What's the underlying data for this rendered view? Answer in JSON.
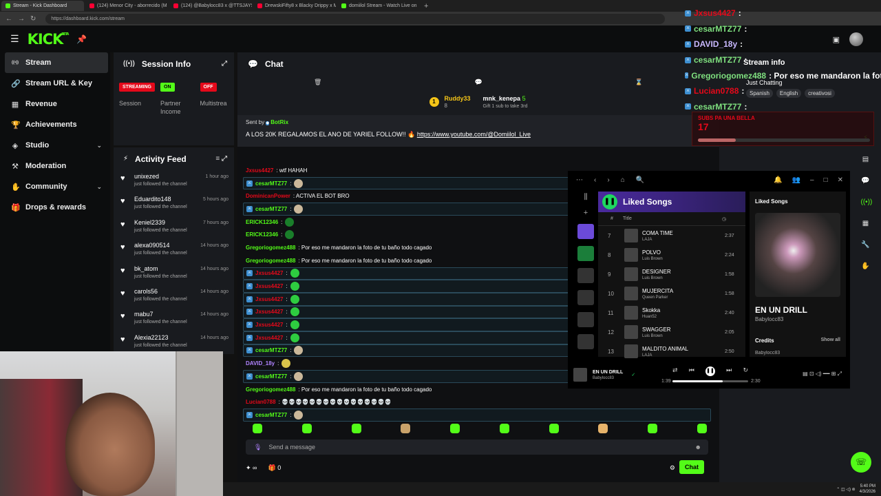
{
  "browser": {
    "tabs": [
      {
        "title": "Stream - Kick Dashboard",
        "color": "#53fc18",
        "active": true
      },
      {
        "title": "(124) Menor City - aborrecido (M",
        "color": "#ff0033",
        "active": false
      },
      {
        "title": "(124) @Babylocc83 x @TTSJAYS",
        "color": "#ff0033",
        "active": false
      },
      {
        "title": "DrewskiFifty8 x Blacky Drippy x M",
        "color": "#ff0033",
        "active": false
      },
      {
        "title": "domiilol Stream - Watch Live on",
        "color": "#53fc18",
        "active": false
      }
    ],
    "new_tab": "+",
    "url": "https://dashboard.kick.com/stream"
  },
  "topbar": {
    "logo": "KICK",
    "logo_sup": "BETA"
  },
  "sidebar": {
    "items": [
      {
        "label": "Stream",
        "icon": "broadcast-icon",
        "glyph": "((•))"
      },
      {
        "label": "Stream URL & Key",
        "icon": "link-icon",
        "glyph": "🔗"
      },
      {
        "label": "Revenue",
        "icon": "bank-icon",
        "glyph": "▦"
      },
      {
        "label": "Achievements",
        "icon": "trophy-icon",
        "glyph": "🏆"
      },
      {
        "label": "Studio",
        "icon": "layers-icon",
        "glyph": "◈",
        "expandable": true
      },
      {
        "label": "Moderation",
        "icon": "hammer-icon",
        "glyph": "⚒"
      },
      {
        "label": "Community",
        "icon": "community-icon",
        "glyph": "✋",
        "expandable": true
      },
      {
        "label": "Drops & rewards",
        "icon": "gift-icon",
        "glyph": "🎁"
      }
    ]
  },
  "session": {
    "title": "Session Info",
    "cols": [
      {
        "badge": "STREAMING",
        "badge_color": "#e5091a",
        "label": "Session"
      },
      {
        "badge": "ON",
        "badge_color": "#53fc18",
        "label": "Partner Income"
      },
      {
        "badge": "OFF",
        "badge_color": "#e5091a",
        "label": "Multistrea"
      }
    ]
  },
  "activity": {
    "title": "Activity Feed",
    "items": [
      {
        "name": "unixezed",
        "action": "just followed the channel",
        "time": "1 hour ago"
      },
      {
        "name": "Eduardito148",
        "action": "just followed the channel",
        "time": "5 hours ago"
      },
      {
        "name": "Keniel2339",
        "action": "just followed the channel",
        "time": "7 hours ago"
      },
      {
        "name": "alexa090514",
        "action": "just followed the channel",
        "time": "14 hours ago"
      },
      {
        "name": "bk_atom",
        "action": "just followed the channel",
        "time": "14 hours ago"
      },
      {
        "name": "carols56",
        "action": "just followed the channel",
        "time": "14 hours ago"
      },
      {
        "name": "mabu7",
        "action": "just followed the channel",
        "time": "14 hours ago"
      },
      {
        "name": "Alexia22123",
        "action": "just followed the channel",
        "time": "14 hours ago"
      }
    ]
  },
  "chat": {
    "title": "Chat",
    "gift": {
      "rank": "1",
      "user": "Ruddy33",
      "count": "8",
      "target": "mnk_kenepa",
      "target_count": "5",
      "gift_text": "Gift 1 sub to take 3rd"
    },
    "pinned": {
      "sent_by": "Sent by",
      "bot": "BotRix",
      "message": "A LOS 20K REGALAMOS EL ANO DE YARIEL FOLLOW!! 🔥",
      "link": "https://www.youtube.com/@Domiilol_Live"
    },
    "messages": [
      {
        "user": "Jxsus4427",
        "text": ": wtf HAHAH",
        "color": "#e5091a",
        "hl": false,
        "badge": false
      },
      {
        "user": "cesarMTZ77",
        "text": ":",
        "color": "#53fc18",
        "hl": true,
        "badge": true
      },
      {
        "user": "DominicanPower",
        "text": ": ACTIVA EL BOT BRO",
        "color": "#e5091a",
        "hl": false,
        "badge": false
      },
      {
        "user": "cesarMTZ77",
        "text": ":",
        "color": "#53fc18",
        "hl": true,
        "badge": true
      },
      {
        "user": "ERICK12346",
        "text": ":",
        "color": "#53fc18",
        "hl": false,
        "badge": false
      },
      {
        "user": "ERICK12346",
        "text": ":",
        "color": "#53fc18",
        "hl": false,
        "badge": false
      },
      {
        "user": "Gregoriogomez488",
        "text": ": Por eso me mandaron la foto de tu baño todo cagado",
        "color": "#53fc18",
        "hl": false,
        "badge": false
      },
      {
        "user": "Gregoriogomez488",
        "text": ": Por eso me mandaron la foto de tu baño todo cagado",
        "color": "#53fc18",
        "hl": false,
        "badge": false
      },
      {
        "user": "Jxsus4427",
        "text": ":",
        "color": "#e5091a",
        "hl": true,
        "badge": true
      },
      {
        "user": "Jxsus4427",
        "text": ":",
        "color": "#e5091a",
        "hl": true,
        "badge": true
      },
      {
        "user": "Jxsus4427",
        "text": ":",
        "color": "#e5091a",
        "hl": true,
        "badge": true
      },
      {
        "user": "Jxsus4427",
        "text": ":",
        "color": "#e5091a",
        "hl": true,
        "badge": true
      },
      {
        "user": "Jxsus4427",
        "text": ":",
        "color": "#e5091a",
        "hl": true,
        "badge": true
      },
      {
        "user": "Jxsus4427",
        "text": ":",
        "color": "#e5091a",
        "hl": true,
        "badge": true
      },
      {
        "user": "cesarMTZ77",
        "text": ":",
        "color": "#53fc18",
        "hl": true,
        "badge": true
      },
      {
        "user": "DAVID_18y",
        "text": ":",
        "color": "#b083ff",
        "hl": false,
        "badge": false
      },
      {
        "user": "cesarMTZ77",
        "text": ":",
        "color": "#53fc18",
        "hl": true,
        "badge": true
      },
      {
        "user": "Gregoriogomez488",
        "text": ": Por eso me mandaron la foto de tu baño todo cagado",
        "color": "#53fc18",
        "hl": false,
        "badge": false
      },
      {
        "user": "Lucian0788",
        "text": ": 💀💀💀💀💀💀💀💀💀💀💀💀💀💀💀💀",
        "color": "#e5091a",
        "hl": false,
        "badge": false
      },
      {
        "user": "cesarMTZ77",
        "text": ":",
        "color": "#53fc18",
        "hl": true,
        "badge": true
      }
    ],
    "send_placeholder": "Send a message",
    "footer_points": "∞",
    "footer_count": "0",
    "chat_button": "Chat"
  },
  "overlay": {
    "rows": [
      {
        "user": "Jxsus4427",
        "text": ":",
        "color": "#e5091a"
      },
      {
        "user": "cesarMTZ77",
        "text": ":",
        "color": "#53fc18"
      },
      {
        "user": "DAVID_18y",
        "text": ":",
        "color": "#b083ff"
      },
      {
        "user": "cesarMTZ77",
        "text": ":",
        "color": "#53fc18"
      },
      {
        "user": "Gregoriogomez488",
        "text": ": Por eso me mandaron la foto",
        "color": "#53fc18"
      },
      {
        "user": "Lucian0788",
        "text": ":",
        "color": "#e5091a"
      },
      {
        "user": "cesarMTZ77",
        "text": ":",
        "color": "#53fc18"
      }
    ]
  },
  "stream_info": {
    "title": "Stream info",
    "category": "Just Chatting",
    "tags": [
      "Spanish",
      "English",
      "creativosi"
    ],
    "sub_banner": "SUBS PA UNA BELLA",
    "sub_count": "17"
  },
  "spotify": {
    "playlist": "Liked Songs",
    "title_col": "Title",
    "tracks": [
      {
        "n": "7",
        "title": "COMA TIME",
        "artist": "LAJA",
        "dur": "2:37"
      },
      {
        "n": "8",
        "title": "POLVO",
        "artist": "Luis Brown",
        "dur": "2:24"
      },
      {
        "n": "9",
        "title": "DESIGNER",
        "artist": "Luis Brown",
        "dur": "1:58"
      },
      {
        "n": "10",
        "title": "MUJERCITA",
        "artist": "Queen Parker",
        "dur": "1:58"
      },
      {
        "n": "11",
        "title": "Skokka",
        "artist": "Huan52",
        "dur": "2:40"
      },
      {
        "n": "12",
        "title": "SWAGGER",
        "artist": "Luis Brown",
        "dur": "2:05"
      },
      {
        "n": "13",
        "title": "MALDITO ANIMAL",
        "artist": "LAJA",
        "dur": "2:50"
      }
    ],
    "side_title": "Liked Songs",
    "now_title": "EN UN DRILL",
    "now_artist": "Babylocc83",
    "credits": "Credits",
    "show_all": "Show all",
    "credit_name": "Babylocc83",
    "bar_title": "EN UN DRILL",
    "bar_artist": "Babylocc83",
    "elapsed": "1:39",
    "total": "2:30",
    "progress": 0.66
  },
  "taskbar": {
    "time": "5:40 PM",
    "date": "4/3/2026"
  }
}
